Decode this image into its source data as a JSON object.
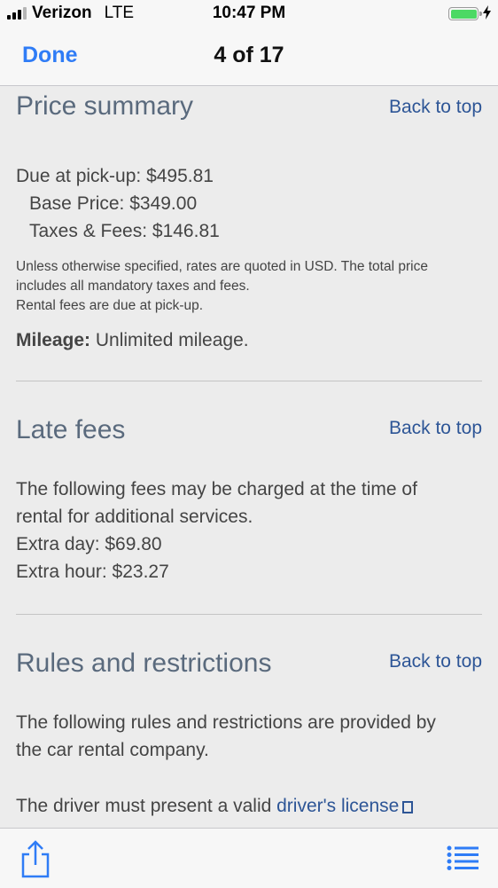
{
  "status_bar": {
    "carrier": "Verizon",
    "network": "LTE",
    "time": "10:47 PM",
    "signal_bars_filled": 3,
    "signal_bars_total": 4,
    "battery_color": "#4cd964",
    "charging": true
  },
  "nav": {
    "done_label": "Done",
    "counter": "4 of 17",
    "accent_color": "#2f7cf6"
  },
  "price_summary": {
    "title": "Price summary",
    "back_to_top": "Back to top",
    "due_at_pickup": "Due at pick-up: $495.81",
    "base_price": "Base Price: $349.00",
    "taxes_fees": "Taxes & Fees: $146.81",
    "note_line1": "Unless otherwise specified, rates are quoted in USD.  The total price",
    "note_line2": "includes all mandatory taxes and fees.",
    "note_line3": "Rental fees are due at pick-up.",
    "mileage_label": "Mileage:",
    "mileage_value": " Unlimited mileage."
  },
  "late_fees": {
    "title": "Late fees",
    "back_to_top": "Back to top",
    "intro_line1": "The following fees may be charged at the time of",
    "intro_line2": "rental for additional services.",
    "extra_day": "Extra day: $69.80",
    "extra_hour": "Extra hour: $23.27"
  },
  "rules": {
    "title": "Rules and restrictions",
    "back_to_top": "Back to top",
    "intro_line1": "The following rules and restrictions are provided by",
    "intro_line2": "the car rental company.",
    "driver_text": "The driver must present a valid ",
    "license_link": "driver's license"
  },
  "toolbar": {
    "share_icon": "share-icon",
    "list_icon": "list-icon"
  }
}
